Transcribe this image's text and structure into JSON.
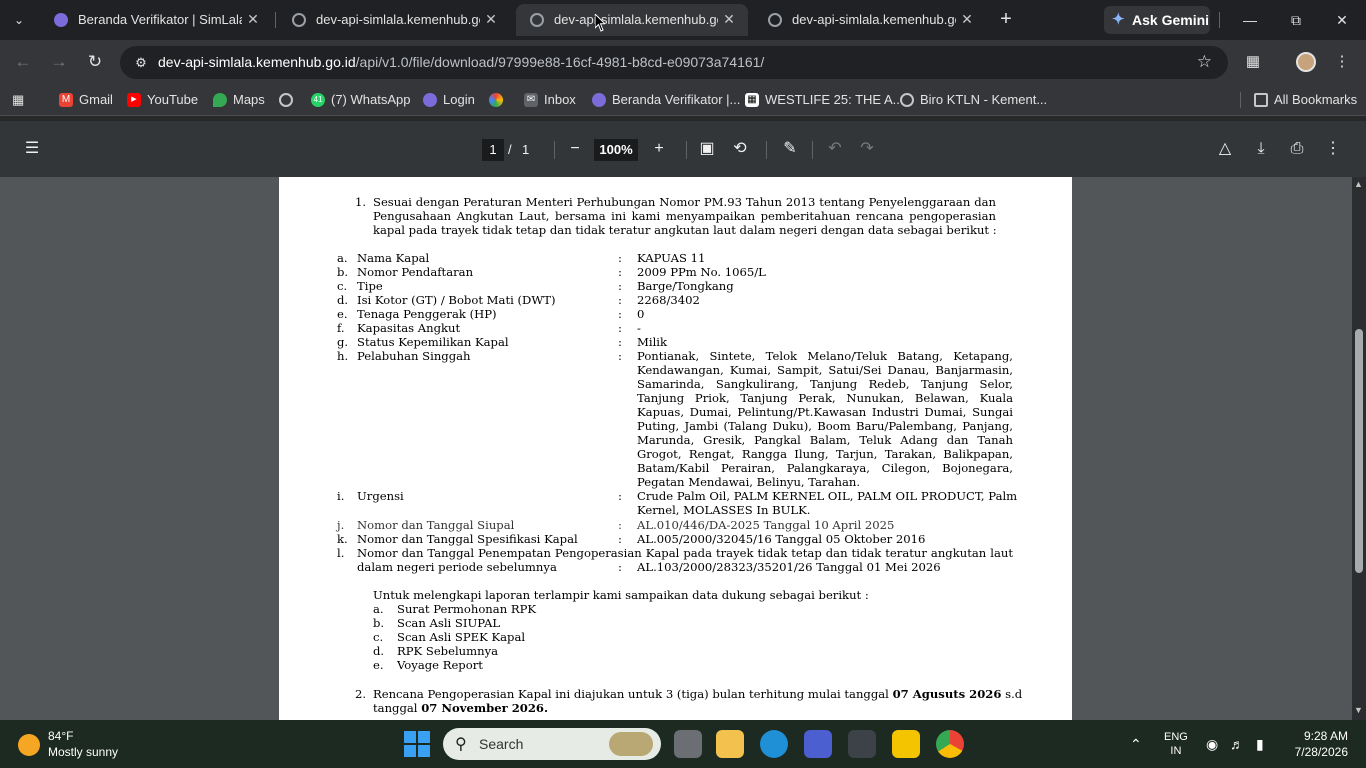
{
  "browser": {
    "tabs": [
      {
        "title": "Beranda Verifikator | SimLala",
        "active": false
      },
      {
        "title": "dev-api-simlala.kemenhub.go.id",
        "active": false
      },
      {
        "title": "dev-api-simlala.kemenhub.go.id",
        "active": true
      },
      {
        "title": "dev-api-simlala.kemenhub.go.id",
        "active": false
      }
    ],
    "ask_gemini": "Ask Gemini",
    "url_host": "dev-api-simlala.kemenhub.go.id",
    "url_path": "/api/v1.0/file/download/97999e88-16cf-4981-b8cd-e09073a74161/",
    "bookmarks": [
      "Gmail",
      "YouTube",
      "Maps",
      "(7) WhatsApp",
      "Login",
      "Inbox",
      "Beranda Verifikator |...",
      "WESTLIFE 25: THE A...",
      "Biro KTLN - Kement..."
    ],
    "whatsapp_badge": "41",
    "all_bookmarks": "All Bookmarks"
  },
  "pdf_viewer": {
    "current_page": "1",
    "page_sep": "/",
    "total_pages": "1",
    "zoom": "100%"
  },
  "document": {
    "p1_num": "1.",
    "p1_lines": [
      "Sesuai dengan Peraturan Menteri Perhubungan Nomor PM.93 Tahun 2013 tentang Penyelenggaraan dan",
      "Pengusahaan Angkutan Laut, bersama ini kami menyampaikan pemberitahuan rencana pengoperasian",
      "kapal pada trayek tidak tetap dan tidak teratur angkutan laut dalam negeri dengan data sebagai berikut :"
    ],
    "colon": ":",
    "fields": [
      {
        "key": "a.",
        "label": "Nama Kapal",
        "value": "KAPUAS 11"
      },
      {
        "key": "b.",
        "label": "Nomor Pendaftaran",
        "value": "2009 PPm No. 1065/L"
      },
      {
        "key": "c.",
        "label": "Tipe",
        "value": "Barge/Tongkang"
      },
      {
        "key": "d.",
        "label": "Isi Kotor (GT) / Bobot Mati (DWT)",
        "value": "2268/3402"
      },
      {
        "key": "e.",
        "label": "Tenaga Penggerak (HP)",
        "value": "0"
      },
      {
        "key": "f.",
        "label": "Kapasitas Angkut",
        "value": "-"
      },
      {
        "key": "g.",
        "label": "Status Kepemilikan Kapal",
        "value": "Milik"
      }
    ],
    "ports_key": "h.",
    "ports_label": "Pelabuhan Singgah",
    "ports_lines": [
      "Pontianak, Sintete, Telok Melano/Teluk Batang, Ketapang,",
      "Kendawangan, Kumai, Sampit, Satui/Sei Danau, Banjarmasin,",
      "Samarinda, Sangkulirang, Tanjung Redeb, Tanjung Selor,",
      "Tanjung Priok, Tanjung Perak, Nunukan, Belawan, Kuala",
      "Kapuas, Dumai, Pelintung/Pt.Kawasan Industri Dumai, Sungai",
      "Puting, Jambi (Talang Duku), Boom Baru/Palembang, Panjang,",
      "Marunda, Gresik, Pangkal Balam, Teluk Adang dan Tanah",
      "Grogot, Rengat, Rangga Ilung, Tarjun, Tarakan, Balikpapan,",
      "Batam/Kabil Perairan, Palangkaraya, Cilegon, Bojonegara,"
    ],
    "ports_last": "Pegatan Mendawai, Belinyu, Tarahan.",
    "urgency_key": "i.",
    "urgency_label": "Urgensi",
    "urgency_line1": "Crude Palm Oil, PALM KERNEL OIL, PALM OIL PRODUCT, Palm",
    "urgency_line2": "Kernel, MOLASSES In BULK.",
    "siupal_key": "j.",
    "siupal_label": "Nomor dan Tanggal Siupal",
    "siupal_value": "AL.010/446/DA-2025 Tanggal 10 April 2025",
    "spek_key": "k.",
    "spek_label": "Nomor dan Tanggal Spesifikasi Kapal",
    "spek_value": "AL.005/2000/32045/16 Tanggal 05 Oktober 2016",
    "prev_key": "l.",
    "prev_label_line1": "Nomor dan Tanggal Penempatan Pengoperasian Kapal pada trayek tidak tetap dan tidak teratur angkutan laut",
    "prev_label_line2": "dalam negeri periode sebelumnya",
    "prev_value": "AL.103/2000/28323/35201/26 Tanggal 01 Mei 2026",
    "support_intro": "Untuk melengkapi laporan terlampir kami sampaikan data dukung sebagai berikut :",
    "support_items": [
      {
        "key": "a.",
        "label": "Surat Permohonan RPK"
      },
      {
        "key": "b.",
        "label": "Scan Asli SIUPAL"
      },
      {
        "key": "c.",
        "label": "Scan Asli SPEK Kapal"
      },
      {
        "key": "d.",
        "label": "RPK Sebelumnya"
      },
      {
        "key": "e.",
        "label": "Voyage Report"
      }
    ],
    "p2_num": "2.",
    "p2_text1": "Rencana Pengoperasian Kapal ini diajukan untuk 3 (tiga) bulan terhitung mulai tanggal",
    "p2_date1": "07 Agusuts 2026",
    "p2_text2": "s.d",
    "p2_text3": "tanggal",
    "p2_date2": "07 November 2026."
  },
  "taskbar": {
    "weather_temp": "84°F",
    "weather_cond": "Mostly sunny",
    "search_placeholder": "Search",
    "lang1": "ENG",
    "lang2": "IN",
    "time": "9:28 AM",
    "date": "7/28/2026"
  }
}
